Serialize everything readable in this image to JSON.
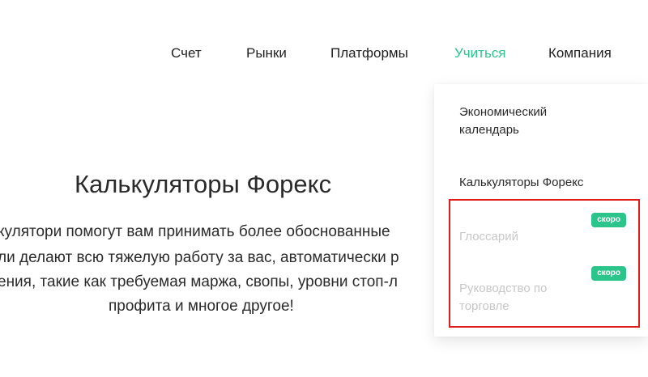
{
  "nav": {
    "items": [
      {
        "label": "Счет"
      },
      {
        "label": "Рынки"
      },
      {
        "label": "Платформы"
      },
      {
        "label": "Учиться",
        "active": true
      },
      {
        "label": "Компания"
      }
    ]
  },
  "hero": {
    "title": "Калькуляторы Форекс",
    "lines": [
      "кулятори помогут вам принимать более обоснованные",
      "ли делают всю тяжелую работу за вас, автоматически р",
      "ения, такие как требуемая маржа, свопы, уровни стоп-л",
      "профита и многое другое!"
    ]
  },
  "dropdown": {
    "items": [
      {
        "label": "Экономический календарь",
        "disabled": false
      },
      {
        "label": "Калькуляторы Форекс",
        "disabled": false
      },
      {
        "label": "Глоссарий",
        "disabled": true,
        "badge": "скоро"
      },
      {
        "label": "Руководство по торговле",
        "disabled": true,
        "badge": "скоро"
      }
    ]
  },
  "colors": {
    "accent": "#2bc48a",
    "highlight": "#e21b1b",
    "disabled_text": "#c7c7c7"
  }
}
